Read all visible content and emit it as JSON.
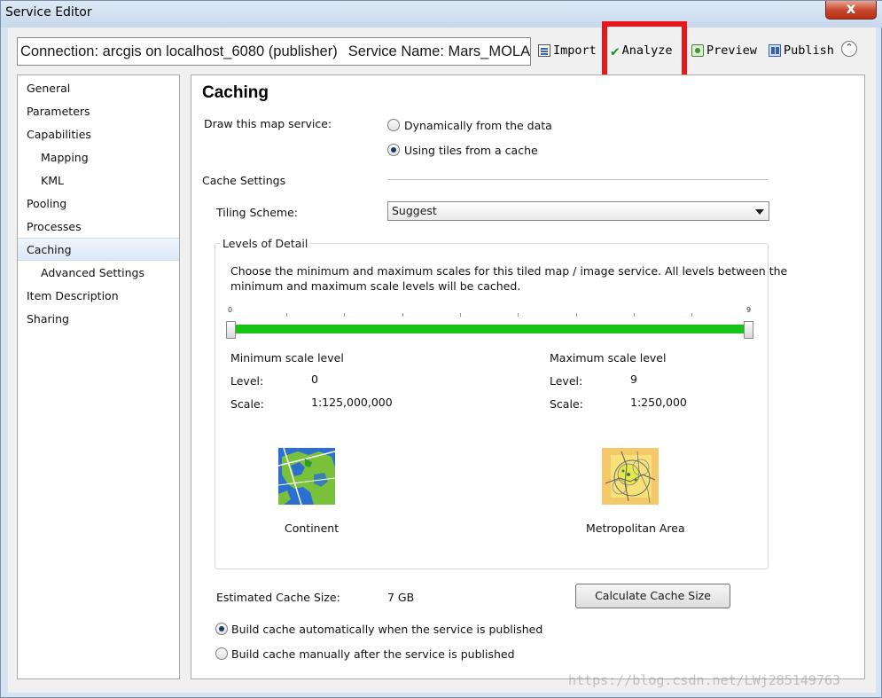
{
  "window": {
    "title": "Service Editor",
    "close_label": "x"
  },
  "toolbar": {
    "connection": "Connection: arcgis on localhost_6080 (publisher)",
    "service_name": "Service Name: Mars_MOLA...",
    "import_label": "Import",
    "analyze_label": "Analyze",
    "preview_label": "Preview",
    "publish_label": "Publish",
    "collapse_glyph": "⌃"
  },
  "sidebar": {
    "items": [
      {
        "label": "General"
      },
      {
        "label": "Parameters"
      },
      {
        "label": "Capabilities"
      },
      {
        "label": "Mapping"
      },
      {
        "label": "KML"
      },
      {
        "label": "Pooling"
      },
      {
        "label": "Processes"
      },
      {
        "label": "Caching"
      },
      {
        "label": "Advanced Settings"
      },
      {
        "label": "Item Description"
      },
      {
        "label": "Sharing"
      }
    ],
    "selected": "Caching"
  },
  "caching": {
    "title": "Caching",
    "draw_label": "Draw this map service:",
    "draw_options": [
      {
        "label": "Dynamically from the data",
        "selected": false
      },
      {
        "label": "Using tiles from a cache",
        "selected": true
      }
    ],
    "cache_settings_label": "Cache Settings",
    "tiling_scheme_label": "Tiling Scheme:",
    "tiling_scheme_value": "Suggest",
    "lod": {
      "title": "Levels of Detail",
      "description_line1": "Choose the minimum and maximum scales for this tiled map / image service. All levels between the",
      "description_line2": "minimum and maximum scale levels will be cached.",
      "slider_min_label": "0",
      "slider_max_label": "9",
      "slider_fill": 1.0,
      "min": {
        "heading": "Minimum scale level",
        "level_label": "Level:",
        "level_value": "0",
        "scale_label": "Scale:",
        "scale_value": "1:125,000,000",
        "image_caption": "Continent"
      },
      "max": {
        "heading": "Maximum scale level",
        "level_label": "Level:",
        "level_value": "9",
        "scale_label": "Scale:",
        "scale_value": "1:250,000",
        "image_caption": "Metropolitan Area"
      }
    },
    "estimated_label": "Estimated Cache Size:",
    "estimated_value": "7 GB",
    "calculate_button": "Calculate Cache Size",
    "build_options": [
      {
        "label": "Build cache automatically when the service is published",
        "selected": true
      },
      {
        "label": "Build cache manually after the service is published",
        "selected": false
      }
    ]
  },
  "watermark": "https://blog.csdn.net/LWj285149763",
  "colors": {
    "highlight": "#e8171c",
    "slider": "#17c317"
  }
}
